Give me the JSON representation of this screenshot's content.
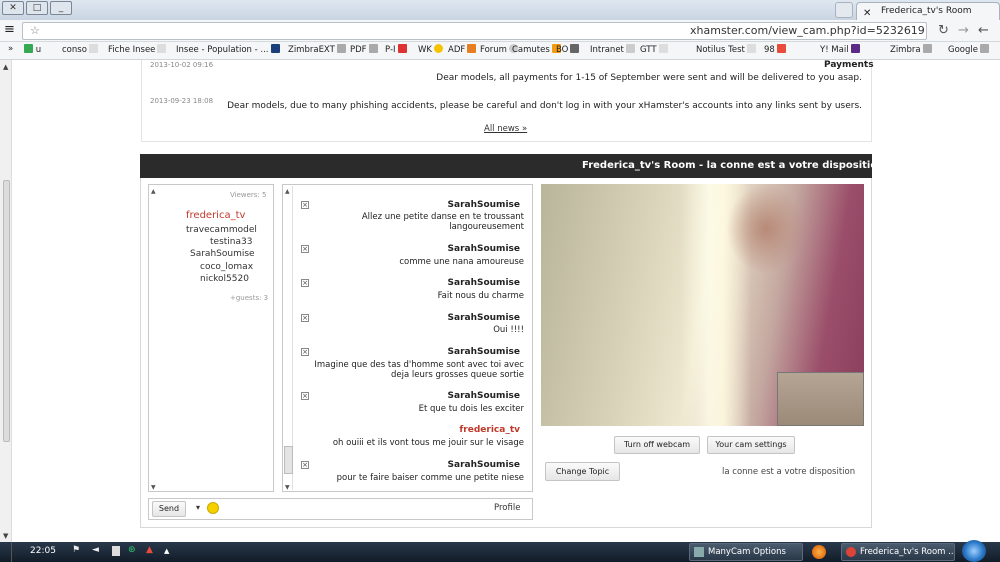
{
  "window": {
    "tab_title": "Frederica_tv's Room",
    "url": "xhamster.com/view_cam.php?id=5232619"
  },
  "bookmarks": {
    "apps_label": "u",
    "items": [
      "conso",
      "Fiche Insee",
      "Insee - Population - ...",
      "ZimbraEXT",
      "PDF",
      "P-I",
      "WK",
      "ADF",
      "Forum",
      "Camutes",
      "BO",
      "Intranet",
      "GTT",
      "Notilus Test",
      "98",
      "Y! Mail",
      "Zimbra",
      "Google"
    ]
  },
  "news": {
    "heading": "Payments",
    "items": [
      {
        "date": "2013-10-02 09:16",
        "text": "Dear models, all payments for 1-15 of September were sent and will be delivered to you asap."
      },
      {
        "date": "2013-09-23 18:08",
        "text": "Dear models, due to many phishing accidents, please be careful and don't log in with your xHamster's accounts into any links sent by users."
      }
    ],
    "all_news_label": "All news »"
  },
  "room": {
    "title": "Frederica_tv's Room - la conne est a votre disposition",
    "topic": "la conne est a votre disposition",
    "change_topic_label": "Change Topic",
    "cam_settings_label": "Your cam settings",
    "turn_off_label": "Turn off webcam"
  },
  "users": {
    "viewers_label": "Viewers: 5",
    "owner": "frederica_tv",
    "list": [
      "travecammodel",
      "testina33",
      "SarahSoumise",
      "coco_lomax",
      "nickol5520"
    ],
    "guests_label": "+guests: 3"
  },
  "chat": {
    "messages": [
      {
        "name": "SarahSoumise",
        "lines": [
          "Allez une petite danse en te troussant",
          "langoureusement"
        ]
      },
      {
        "name": "SarahSoumise",
        "lines": [
          "comme une nana amoureuse"
        ]
      },
      {
        "name": "SarahSoumise",
        "lines": [
          "Fait nous du charme"
        ]
      },
      {
        "name": "SarahSoumise",
        "lines": [
          "Oui !!!!"
        ]
      },
      {
        "name": "SarahSoumise",
        "lines": [
          "Imagine que des tas d'homme sont avec toi avec",
          "deja leurs grosses queue sortie"
        ]
      },
      {
        "name": "SarahSoumise",
        "lines": [
          "Et que tu dois les exciter"
        ]
      },
      {
        "name": "frederica_tv",
        "lines": [
          "oh ouiii et ils vont tous me jouir sur le visage"
        ]
      },
      {
        "name": "SarahSoumise",
        "lines": [
          "pour te faire baiser comme une petite niese"
        ]
      }
    ],
    "send_label": "Send",
    "profile_label": "Profile"
  },
  "taskbar": {
    "tasks": [
      "Frederica_tv's Room ...",
      "ManyCam Options"
    ],
    "clock": "22:05"
  },
  "colors": {
    "owner_red": "#c0392b",
    "header_dark": "#2b2b2b",
    "taskbar": "#1c2a3a"
  }
}
